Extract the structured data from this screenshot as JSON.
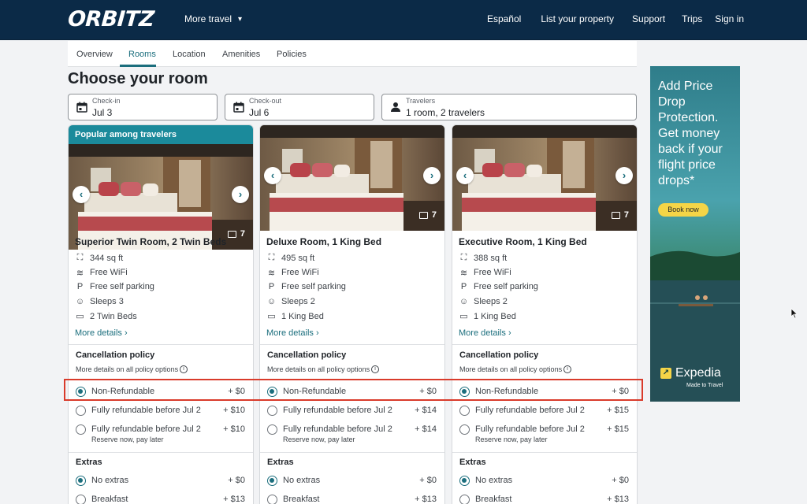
{
  "header": {
    "logo": "ORBITZ",
    "more_travel": "More travel",
    "nav": [
      "Español",
      "List your property",
      "Support",
      "Trips",
      "Sign in"
    ]
  },
  "tabs": [
    "Overview",
    "Rooms",
    "Location",
    "Amenities",
    "Policies"
  ],
  "active_tab": "Rooms",
  "page_title": "Choose your room",
  "search": {
    "checkin_label": "Check-in",
    "checkin_value": "Jul 3",
    "checkout_label": "Check-out",
    "checkout_value": "Jul 6",
    "travelers_label": "Travelers",
    "travelers_value": "1 room, 2 travelers"
  },
  "rooms": [
    {
      "badge": "Popular among travelers",
      "photo_count": "7",
      "name": "Superior Twin Room, 2 Twin Beds",
      "amenities": [
        {
          "icon": "floor-area-icon",
          "text": "344 sq ft"
        },
        {
          "icon": "wifi-icon",
          "text": "Free WiFi"
        },
        {
          "icon": "parking-icon",
          "text": "Free self parking"
        },
        {
          "icon": "people-icon",
          "text": "Sleeps 3"
        },
        {
          "icon": "bed-icon",
          "text": "2 Twin Beds"
        }
      ],
      "more_details": "More details",
      "cancellation_title": "Cancellation policy",
      "policy_link": "More details on all policy options",
      "options": [
        {
          "label": "Non-Refundable",
          "price": "+ $0",
          "selected": true
        },
        {
          "label": "Fully refundable before Jul 2",
          "price": "+ $10",
          "selected": false
        },
        {
          "label": "Fully refundable before Jul 2",
          "price": "+ $10",
          "sub": "Reserve now, pay later",
          "selected": false
        }
      ],
      "extras_title": "Extras",
      "extras": [
        {
          "label": "No extras",
          "price": "+ $0",
          "selected": true
        },
        {
          "label": "Breakfast",
          "price": "+ $13",
          "selected": false
        }
      ]
    },
    {
      "badge": "",
      "photo_count": "7",
      "name": "Deluxe Room, 1 King Bed",
      "amenities": [
        {
          "icon": "floor-area-icon",
          "text": "495 sq ft"
        },
        {
          "icon": "wifi-icon",
          "text": "Free WiFi"
        },
        {
          "icon": "parking-icon",
          "text": "Free self parking"
        },
        {
          "icon": "people-icon",
          "text": "Sleeps 2"
        },
        {
          "icon": "bed-icon",
          "text": "1 King Bed"
        }
      ],
      "more_details": "More details",
      "cancellation_title": "Cancellation policy",
      "policy_link": "More details on all policy options",
      "options": [
        {
          "label": "Non-Refundable",
          "price": "+ $0",
          "selected": true
        },
        {
          "label": "Fully refundable before Jul 2",
          "price": "+ $14",
          "selected": false
        },
        {
          "label": "Fully refundable before Jul 2",
          "price": "+ $14",
          "sub": "Reserve now, pay later",
          "selected": false
        }
      ],
      "extras_title": "Extras",
      "extras": [
        {
          "label": "No extras",
          "price": "+ $0",
          "selected": true
        },
        {
          "label": "Breakfast",
          "price": "+ $13",
          "selected": false
        }
      ]
    },
    {
      "badge": "",
      "photo_count": "7",
      "name": "Executive Room, 1 King Bed",
      "amenities": [
        {
          "icon": "floor-area-icon",
          "text": "388 sq ft"
        },
        {
          "icon": "wifi-icon",
          "text": "Free WiFi"
        },
        {
          "icon": "parking-icon",
          "text": "Free self parking"
        },
        {
          "icon": "people-icon",
          "text": "Sleeps 2"
        },
        {
          "icon": "bed-icon",
          "text": "1 King Bed"
        }
      ],
      "more_details": "More details",
      "cancellation_title": "Cancellation policy",
      "policy_link": "More details on all policy options",
      "options": [
        {
          "label": "Non-Refundable",
          "price": "+ $0",
          "selected": true
        },
        {
          "label": "Fully refundable before Jul 2",
          "price": "+ $15",
          "selected": false
        },
        {
          "label": "Fully refundable before Jul 2",
          "price": "+ $15",
          "sub": "Reserve now, pay later",
          "selected": false
        }
      ],
      "extras_title": "Extras",
      "extras": [
        {
          "label": "No extras",
          "price": "+ $0",
          "selected": true
        },
        {
          "label": "Breakfast",
          "price": "+ $13",
          "selected": false
        }
      ]
    }
  ],
  "ad": {
    "headline": "Add Price Drop Protection. Get money back if your flight price drops*",
    "button": "Book now",
    "brand": "Expedia",
    "tagline": "Made to Travel"
  },
  "colors": {
    "header_bg": "#0b2a47",
    "accent": "#1b6e7d",
    "badge_bg": "#1b8a9b",
    "highlight": "#d93b2b",
    "ad_button": "#f5d547"
  }
}
